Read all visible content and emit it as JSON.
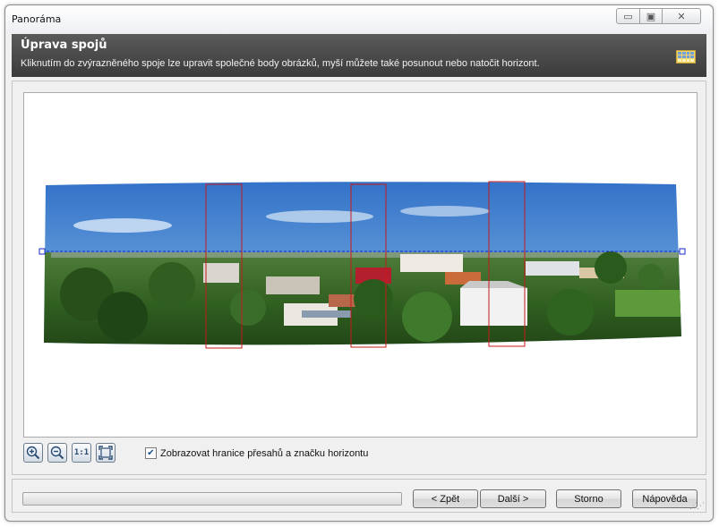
{
  "window": {
    "title": "Panoráma",
    "controls": {
      "minimize": "▭",
      "maximize": "▣",
      "close": "✕"
    }
  },
  "header": {
    "title": "Úprava spojů",
    "subtitle": "Kliknutím do zvýrazněného spoje lze upravit společné body obrázků, myší můžete také posunout nebo natočit horizont.",
    "icon": "panorama-icon"
  },
  "canvas": {
    "content": "stitched-panorama-image",
    "seam_count": 3,
    "horizon_line": true,
    "colors": {
      "seam": "#c41a1a",
      "horizon": "#1428c8",
      "sky": "#3f7fd0",
      "greenery": "#2f6b22"
    }
  },
  "toolbar": {
    "zoom_in": "zoom-in-icon",
    "zoom_out": "zoom-out-icon",
    "actual_size_label": "1:1",
    "fit": "fit-to-window-icon",
    "show_borders_checked": true,
    "show_borders_label": "Zobrazovat hranice přesahů a značku horizontu"
  },
  "footer": {
    "progress": 0,
    "back_label": "< Zpět",
    "next_label": "Další >",
    "cancel_label": "Storno",
    "help_label": "Nápověda"
  }
}
